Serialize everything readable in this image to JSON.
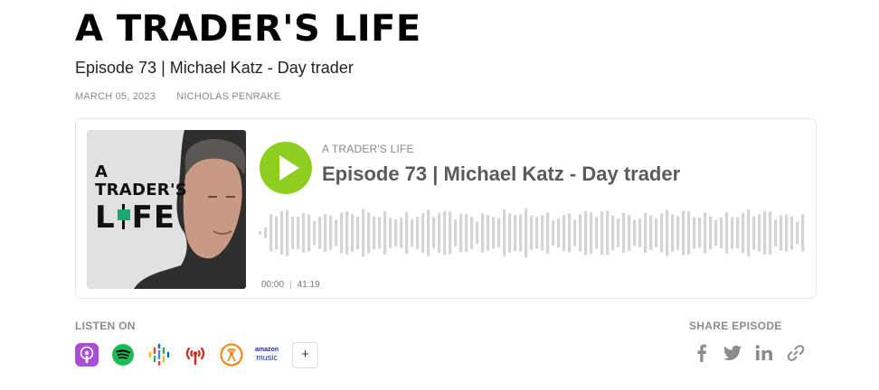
{
  "header": {
    "show_title": "A TRADER'S LIFE",
    "episode_title": "Episode 73 | Michael Katz - Day trader",
    "date": "MARCH 05, 2023",
    "author": "NICHOLAS PENRAKE"
  },
  "player": {
    "podcast_name": "A TRADER'S LIFE",
    "episode_title": "Episode 73 | Michael Katz - Day trader",
    "current_time": "00:00",
    "duration": "41:19",
    "artwork": {
      "line1": "A",
      "line2": "TRADER'S",
      "line3_left": "L",
      "line3_right": "FE"
    },
    "play_color": "#8fcd1f",
    "waveform_color": "#d4d4d4"
  },
  "listen": {
    "label": "LISTEN ON",
    "platforms": [
      "apple-podcasts-icon",
      "spotify-icon",
      "google-podcasts-icon",
      "podcast-antenna-icon",
      "overcast-icon",
      "amazon-music-icon"
    ],
    "amazon_line1": "amazon",
    "amazon_line2": "music",
    "more_label": "+"
  },
  "share": {
    "label": "SHARE EPISODE",
    "icons": [
      "facebook-icon",
      "twitter-icon",
      "linkedin-icon",
      "link-icon"
    ]
  }
}
